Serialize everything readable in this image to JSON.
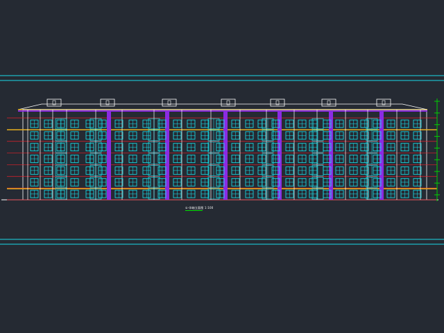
{
  "drawing": {
    "elevation_title": "①-⑳轴立面图",
    "scale": "1:100",
    "floors": 7,
    "bays": 7,
    "colors": {
      "background": "#252a33",
      "frame_lines": "#19d9e8",
      "window": "#18e6f0",
      "wall_outline": "#ffffff",
      "stair_strip": "#8a2be2",
      "floor_line": "#e8202a",
      "band": "#e8b020",
      "grade_marker": "#00d000"
    }
  }
}
